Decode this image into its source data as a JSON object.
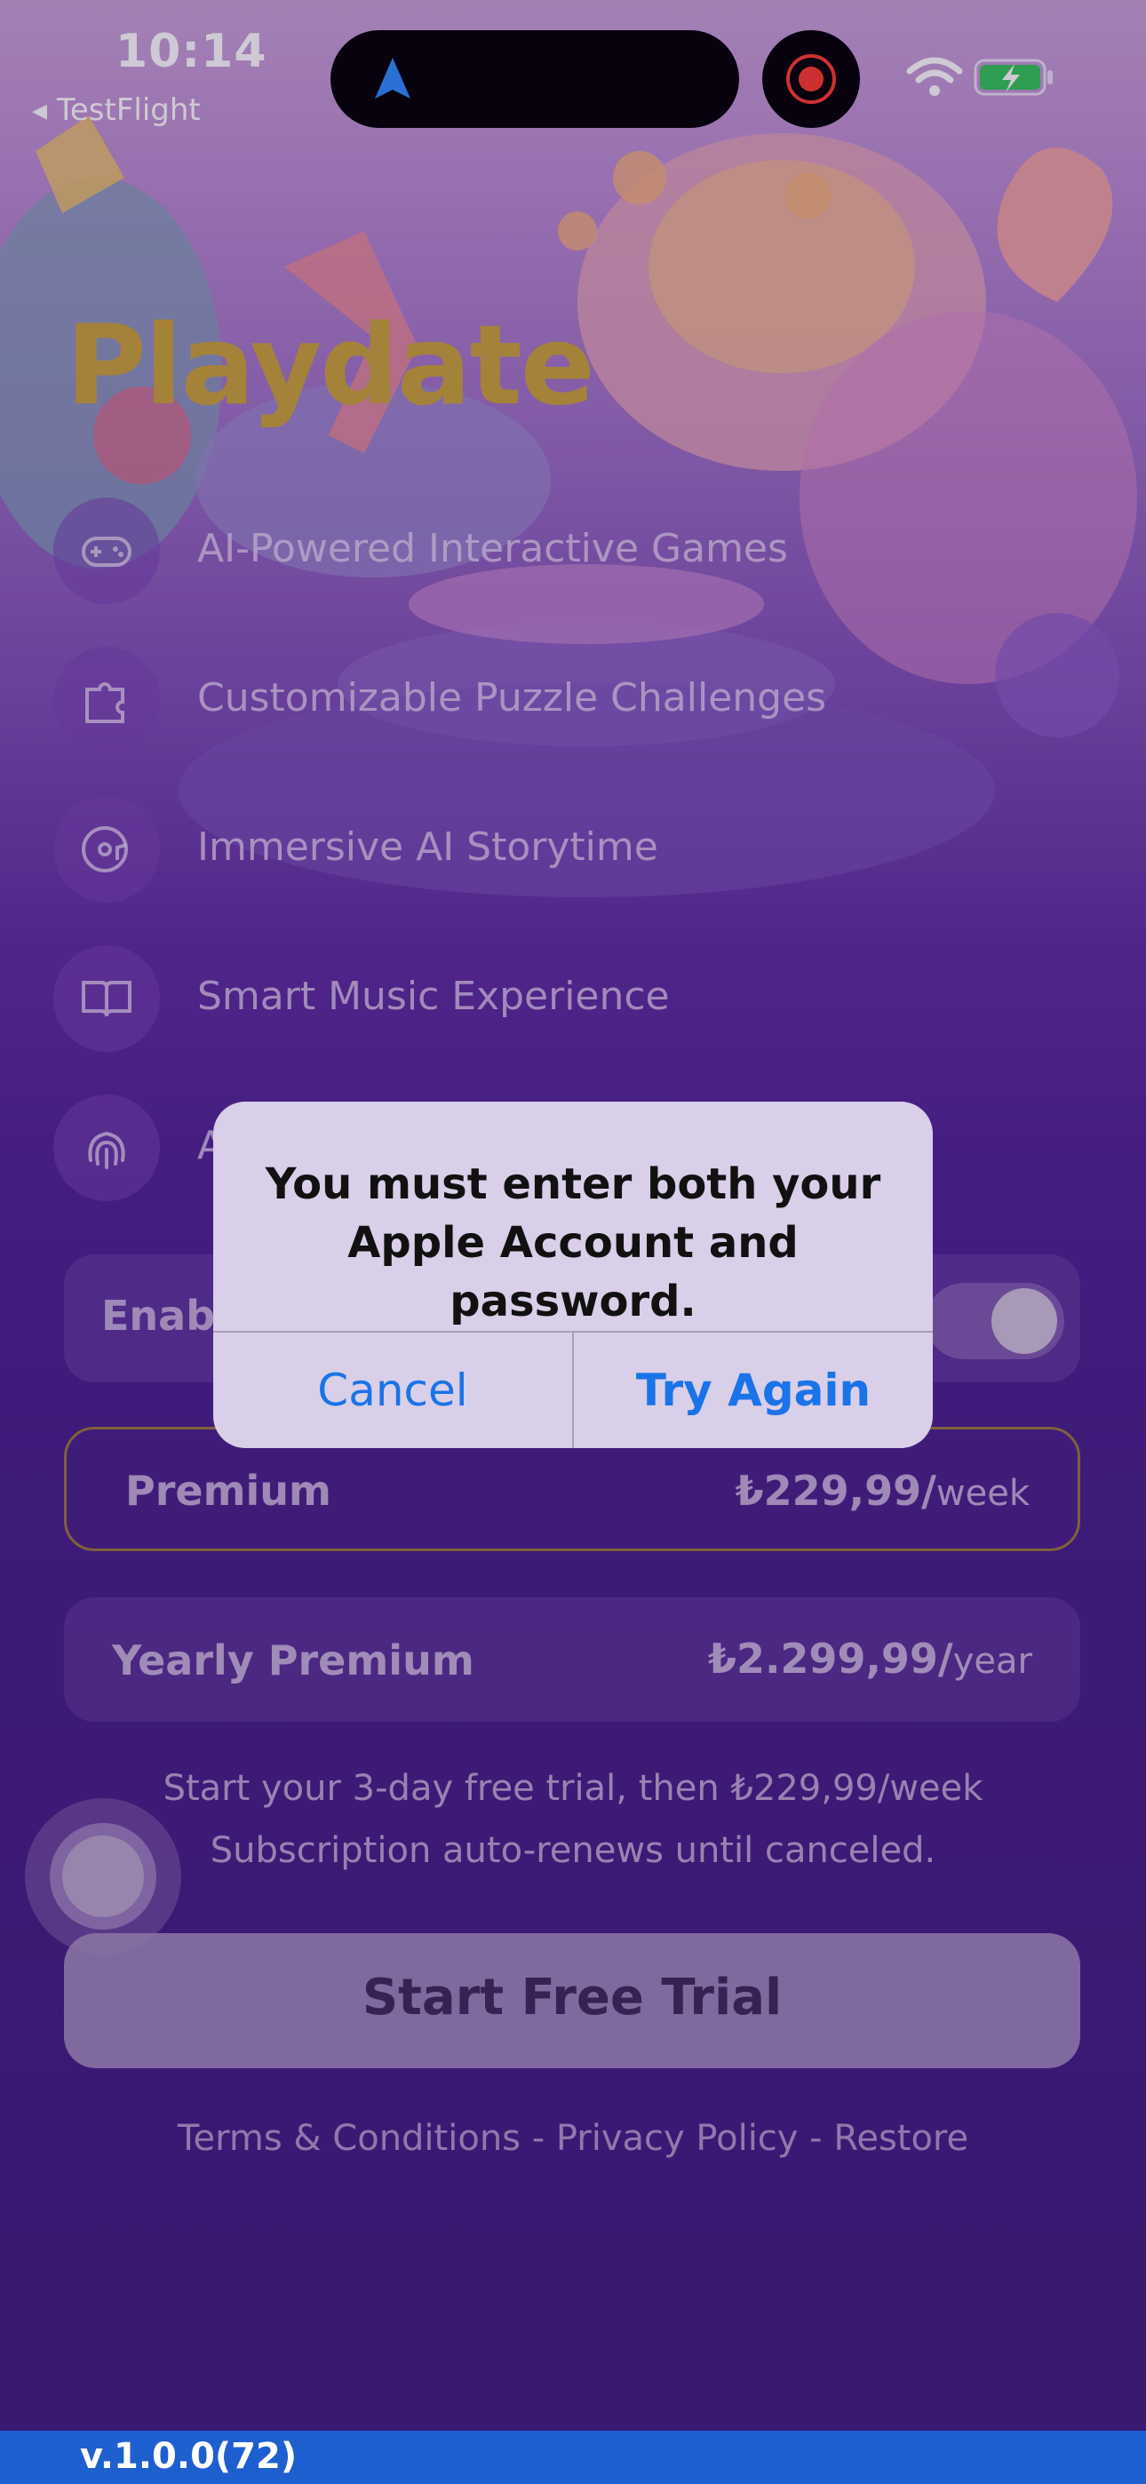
{
  "status_bar": {
    "time": "10:14",
    "back_label": "◂ TestFlight"
  },
  "app": {
    "title": "Playdate"
  },
  "features": [
    {
      "icon": "gamepad-icon",
      "label": "AI-Powered Interactive Games"
    },
    {
      "icon": "puzzle-icon",
      "label": "Customizable Puzzle Challenges"
    },
    {
      "icon": "music-disc-icon",
      "label": "Immersive AI Storytime"
    },
    {
      "icon": "book-icon",
      "label": "Smart Music Experience"
    },
    {
      "icon": "fingerprint-icon",
      "label": "A"
    }
  ],
  "toggle_card": {
    "label": "Enabl"
  },
  "plans": [
    {
      "name": "Premium",
      "price": "₺229,99/",
      "period": "week",
      "selected": true
    },
    {
      "name": "Yearly Premium",
      "price": "₺2.299,99/",
      "period": "year",
      "selected": false
    }
  ],
  "trial": {
    "line1": "Start your 3-day free trial, then ₺229,99/week",
    "line2": "Subscription auto-renews until canceled."
  },
  "cta": {
    "label": "Start Free Trial"
  },
  "footer_links": "Terms & Conditions - Privacy Policy - Restore",
  "version": "v.1.0.0(72)",
  "alert": {
    "message": "You must enter both your Apple Account and password.",
    "cancel_label": "Cancel",
    "retry_label": "Try Again"
  },
  "colors": {
    "accent_title": "#c9a53a",
    "alert_button": "#1a73e8",
    "version_bar": "#1e5fd0"
  }
}
